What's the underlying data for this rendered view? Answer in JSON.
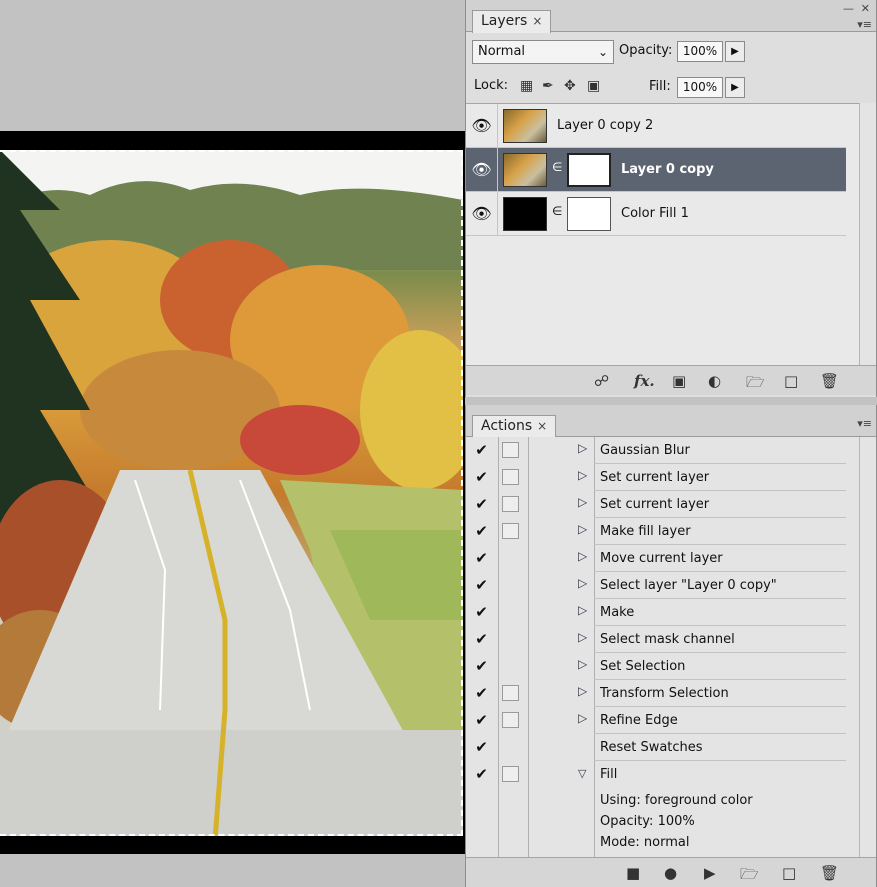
{
  "layers_panel": {
    "tab_label": "Layers",
    "tab_close": "×",
    "blend_mode": "Normal",
    "opacity_label": "Opacity:",
    "opacity_value": "100%",
    "lock_label": "Lock:",
    "fill_label": "Fill:",
    "fill_value": "100%",
    "layers": [
      {
        "name": "Layer 0 copy 2",
        "visible": true,
        "selected": false,
        "has_mask": false
      },
      {
        "name": "Layer 0 copy",
        "visible": true,
        "selected": true,
        "has_mask": true
      },
      {
        "name": "Color Fill 1",
        "visible": true,
        "selected": false,
        "has_mask": true
      }
    ],
    "footer_icons": [
      "link-icon",
      "fx-icon",
      "add-mask-icon",
      "adjustment-layer-icon",
      "new-group-icon",
      "new-layer-icon",
      "delete-icon"
    ],
    "fx_label": "fx."
  },
  "actions_panel": {
    "tab_label": "Actions",
    "tab_close": "×",
    "actions": [
      {
        "label": "Gaussian Blur",
        "checked": true,
        "dialog_box": true
      },
      {
        "label": "Set current layer",
        "checked": true,
        "dialog_box": true
      },
      {
        "label": "Set current layer",
        "checked": true,
        "dialog_box": true
      },
      {
        "label": "Make fill layer",
        "checked": true,
        "dialog_box": true
      },
      {
        "label": "Move current layer",
        "checked": true,
        "dialog_box": false
      },
      {
        "label": "Select layer \"Layer 0 copy\"",
        "checked": true,
        "dialog_box": false
      },
      {
        "label": "Make",
        "checked": true,
        "dialog_box": false
      },
      {
        "label": "Select mask channel",
        "checked": true,
        "dialog_box": false
      },
      {
        "label": "Set Selection",
        "checked": true,
        "dialog_box": false
      },
      {
        "label": "Transform Selection",
        "checked": true,
        "dialog_box": true
      },
      {
        "label": "Refine Edge",
        "checked": true,
        "dialog_box": true
      },
      {
        "label": "Reset Swatches",
        "checked": true,
        "dialog_box": false
      },
      {
        "label": "Fill",
        "checked": true,
        "dialog_box": true,
        "expanded": true
      }
    ],
    "fill_details": [
      "Using: foreground color",
      "Opacity: 100%",
      "Mode: normal"
    ],
    "footer_icons": [
      "stop-icon",
      "record-icon",
      "play-icon",
      "new-set-icon",
      "new-action-icon",
      "delete-icon"
    ]
  },
  "colors": {
    "selected_row": "#5c6472",
    "panel_bg": "#dedede",
    "workspace_bg": "#c2c2c2"
  }
}
